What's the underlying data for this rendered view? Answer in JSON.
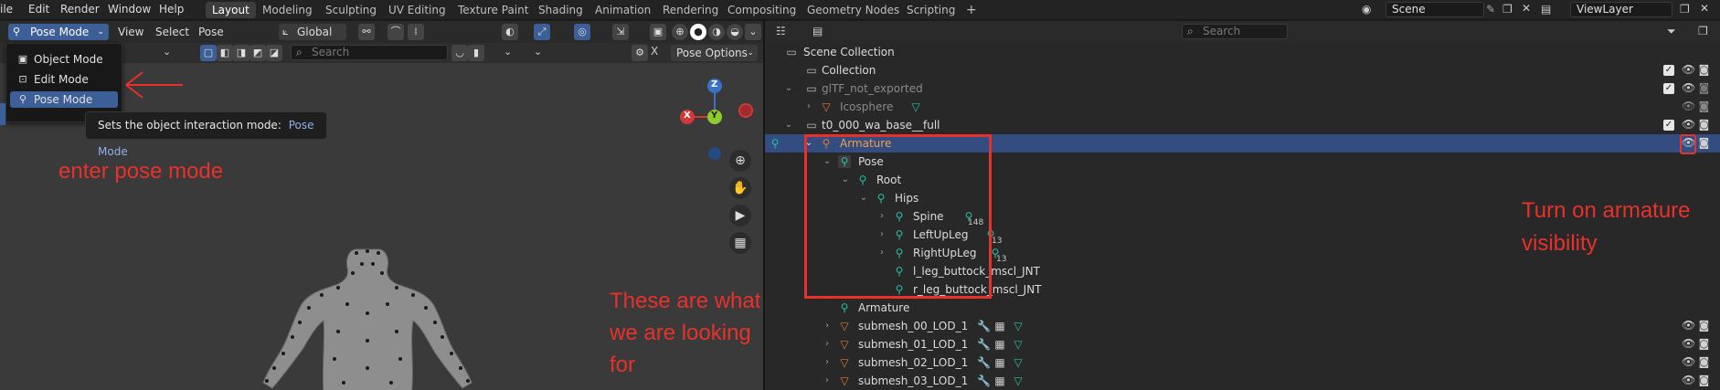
{
  "topbar": {
    "menus": [
      "ile",
      "Edit",
      "Render",
      "Window",
      "Help"
    ],
    "workspaces": [
      "Layout",
      "Modeling",
      "Sculpting",
      "UV Editing",
      "Texture Paint",
      "Shading",
      "Animation",
      "Rendering",
      "Compositing",
      "Geometry Nodes",
      "Scripting"
    ],
    "active_workspace": "Layout",
    "add_tab": "+",
    "scene": "Scene",
    "view_layer": "ViewLayer"
  },
  "viewport": {
    "mode": "Pose Mode",
    "menus": [
      "View",
      "Select",
      "Pose"
    ],
    "orientation": "Global",
    "search_placeholder": "Search",
    "pose_options": "Pose Options",
    "close_x": "X",
    "dropdown_items": [
      "Object Mode",
      "Edit Mode",
      "Pose Mode"
    ],
    "selected_mode": "Pose Mode",
    "tooltip_text": "Sets the object interaction mode:",
    "tooltip_value": "Pose Mode",
    "gizmo": {
      "z": "Z",
      "y": "Y",
      "x": "X"
    }
  },
  "annotations": {
    "enter_pose": "enter pose mode",
    "looking_for": [
      "These are what",
      "we are looking",
      "for"
    ],
    "turn_on": [
      "Turn on armature",
      "visibility"
    ],
    "color": "#e8312b"
  },
  "outliner": {
    "search_placeholder": "Search",
    "rows": [
      {
        "label": "Scene Collection"
      },
      {
        "label": "Collection"
      },
      {
        "label": "glTF_not_exported"
      },
      {
        "label": "Icosphere"
      },
      {
        "label": "t0_000_wa_base__full"
      },
      {
        "label": "Armature"
      },
      {
        "label": "Pose"
      },
      {
        "label": "Root"
      },
      {
        "label": "Hips"
      },
      {
        "label": "Spine",
        "count": "148"
      },
      {
        "label": "LeftUpLeg",
        "count": "13"
      },
      {
        "label": "RightUpLeg",
        "count": "13"
      },
      {
        "label": "l_leg_buttock_mscl_JNT"
      },
      {
        "label": "r_leg_buttock_mscl_JNT"
      },
      {
        "label": "Armature"
      },
      {
        "label": "submesh_00_LOD_1"
      },
      {
        "label": "submesh_01_LOD_1"
      },
      {
        "label": "submesh_02_LOD_1"
      },
      {
        "label": "submesh_03_LOD_1"
      }
    ]
  },
  "colors": {
    "highlight": "#334d80",
    "bone": "#22c0a3",
    "armature": "#e07a2a",
    "selection": "#3d5f98"
  }
}
